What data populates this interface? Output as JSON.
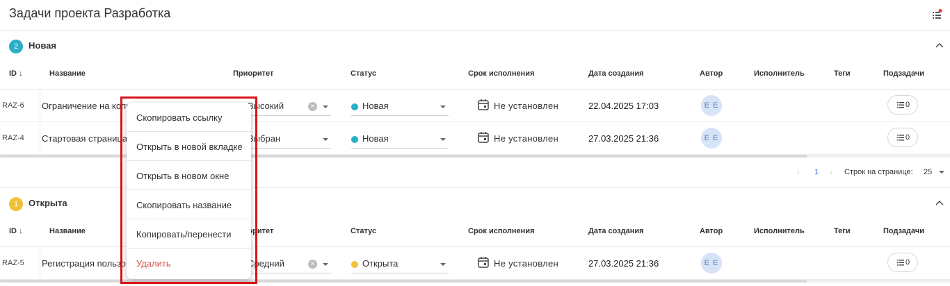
{
  "header": {
    "title": "Задачи проекта Разработка"
  },
  "columns": {
    "id": "ID",
    "name": "Название",
    "priority": "Приоритет",
    "status": "Статус",
    "due": "Срок исполнения",
    "created": "Дата создания",
    "author": "Автор",
    "assignee": "Исполнитель",
    "tags": "Теги",
    "subtasks": "Подзадачи"
  },
  "groups": [
    {
      "name": "Новая",
      "count": "2",
      "color": "#2aaec7",
      "rows": [
        {
          "id": "RAZ-6",
          "name": "Ограничение на копи",
          "priority": "Высокий",
          "status": "Новая",
          "due": "Не установлен",
          "created": "22.04.2025 17:03",
          "author": "E E",
          "subtasks": "0"
        },
        {
          "id": "RAZ-4",
          "name": "Стартовая страница",
          "priority": "Выбран",
          "status": "Новая",
          "due": "Не установлен",
          "created": "27.03.2025 21:36",
          "author": "E E",
          "subtasks": "0"
        }
      ]
    },
    {
      "name": "Открыта",
      "count": "1",
      "color": "#efc23a",
      "rows": [
        {
          "id": "RAZ-5",
          "name": "Регистрация пользо",
          "priority": "Средний",
          "status": "Открыта",
          "due": "Не установлен",
          "created": "27.03.2025 21:36",
          "author": "E E",
          "subtasks": "0"
        }
      ]
    }
  ],
  "pagination": {
    "page": "1",
    "rows_per_page_label": "Строк на странице:",
    "rows_per_page": "25"
  },
  "context_menu": {
    "items": [
      "Скопировать ссылку",
      "Открыть в новой вкладке",
      "Открыть в новом окне",
      "Скопировать название",
      "Копировать/перенести",
      "Удалить"
    ]
  },
  "colors": {
    "highlight": "#d7141a",
    "danger": "#d9534f",
    "link": "#3f7fd6"
  }
}
